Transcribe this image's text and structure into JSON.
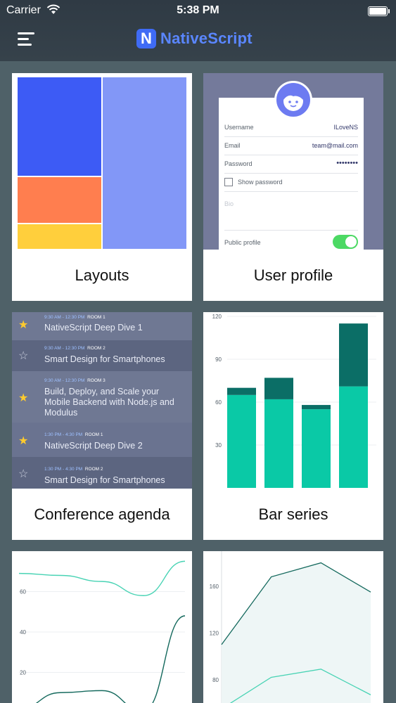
{
  "status_bar": {
    "carrier": "Carrier",
    "time": "5:38 PM"
  },
  "app": {
    "logo_letter": "N",
    "brand_name": "NativeScript"
  },
  "cards": {
    "layouts": {
      "label": "Layouts"
    },
    "user_profile": {
      "label": "User profile",
      "rows": [
        {
          "key": "Username",
          "value": "ILoveNS"
        },
        {
          "key": "Email",
          "value": "team@mail.com"
        },
        {
          "key": "Password",
          "value": "••••••••"
        }
      ],
      "show_password": "Show password",
      "bio_placeholder": "Bio",
      "public_profile": "Public profile",
      "public_profile_on": true
    },
    "agenda": {
      "label": "Conference agenda",
      "sessions": [
        {
          "time": "9:30 AM - 12:30 PM",
          "room": "ROOM 1",
          "title": "NativeScript Deep Dive 1",
          "starred": true
        },
        {
          "time": "9:30 AM - 12:30 PM",
          "room": "ROOM 2",
          "title": "Smart Design for Smartphones",
          "starred": false
        },
        {
          "time": "9:30 AM - 12:30 PM",
          "room": "ROOM 3",
          "title": "Build, Deploy, and Scale your Mobile Backend with Node.js and Modulus",
          "starred": true
        },
        {
          "time": "1:30 PM - 4:30 PM",
          "room": "ROOM 1",
          "title": "NativeScript Deep Dive 2",
          "starred": true
        },
        {
          "time": "1:30 PM - 4:30 PM",
          "room": "ROOM 2",
          "title": "Smart Design for Smartphones",
          "starred": false
        }
      ]
    },
    "bar_series": {
      "label": "Bar series"
    }
  },
  "chart_data": [
    {
      "type": "bar",
      "ylim": [
        0,
        120
      ],
      "ticks": [
        30,
        60,
        90,
        120
      ],
      "series": [
        {
          "values": [
            65,
            62,
            55,
            71
          ],
          "color": "#0ac9a6"
        },
        {
          "values": [
            5,
            15,
            3,
            44
          ],
          "color": "#0b6e66"
        }
      ],
      "categories": [
        "",
        "",
        "",
        ""
      ]
    },
    {
      "type": "line",
      "ylim": [
        0,
        80
      ],
      "ticks": [
        20,
        40,
        60
      ],
      "x": [
        0,
        1,
        2,
        3,
        4
      ],
      "series": [
        {
          "values": [
            69,
            68,
            65,
            58,
            75
          ],
          "color": "#48d3b4"
        },
        {
          "values": [
            2,
            10,
            11,
            1,
            48
          ],
          "color": "#14695d"
        }
      ]
    },
    {
      "type": "area",
      "ylim": [
        60,
        190
      ],
      "ticks": [
        80,
        120,
        160
      ],
      "x": [
        0,
        1,
        2,
        3
      ],
      "series": [
        {
          "values": [
            110,
            168,
            180,
            155
          ],
          "color": "#14695d"
        },
        {
          "values": [
            55,
            82,
            89,
            67
          ],
          "color": "#48d3b4"
        }
      ]
    }
  ]
}
